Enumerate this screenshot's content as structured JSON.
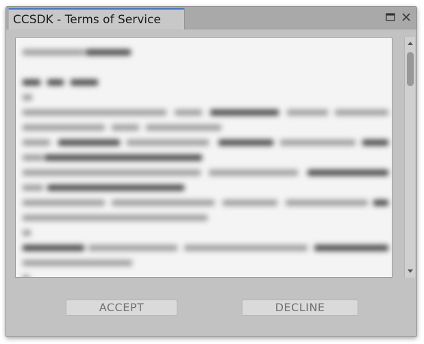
{
  "window": {
    "title": "CCSDK - Terms of Service"
  },
  "icons": {
    "maximize": "maximize-icon",
    "close": "close-icon",
    "scroll_up": "arrow-up-icon",
    "scroll_down": "arrow-down-icon"
  },
  "buttons": {
    "accept_label": "ACCEPT",
    "decline_label": "DECLINE"
  },
  "colors": {
    "accent_tab": "#3a78d0",
    "window_bg": "#c2c2c2",
    "content_bg": "#f4f4f4"
  }
}
